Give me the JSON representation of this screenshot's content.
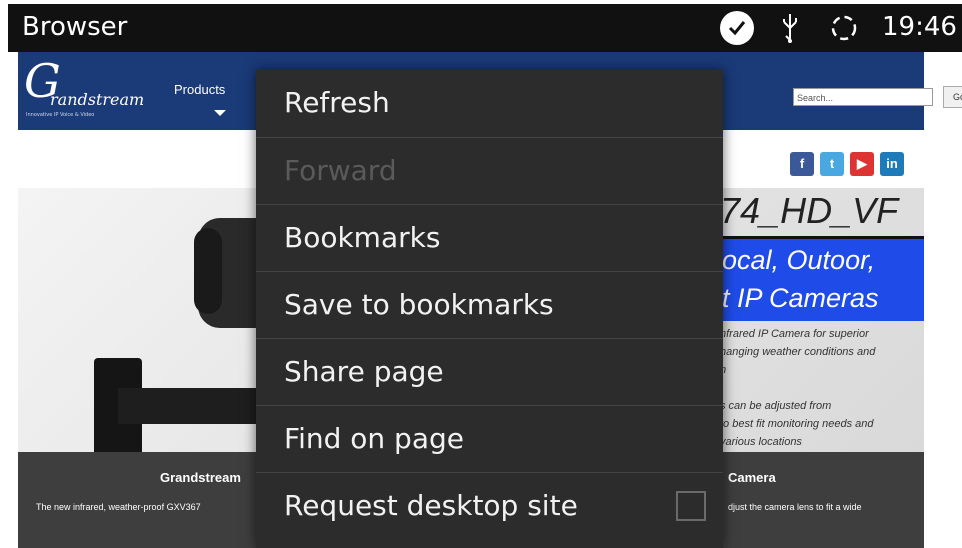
{
  "statusbar": {
    "title": "Browser",
    "clock": "19:46",
    "icons": [
      "checkmark-badge-icon",
      "usb-icon",
      "sync-icon"
    ]
  },
  "webpage": {
    "header": {
      "logo_letter": "G",
      "logo_word": "randstream",
      "logo_tagline": "Innovative IP Voice & Video",
      "nav_products": "Products",
      "search_placeholder": "Search...",
      "search_button": "Go"
    },
    "social": [
      {
        "icon": "facebook-icon",
        "glyph": "f",
        "color": "#3b5998"
      },
      {
        "icon": "twitter-icon",
        "glyph": "t",
        "color": "#4aa8e0"
      },
      {
        "icon": "youtube-icon",
        "glyph": "▶",
        "color": "#d33"
      },
      {
        "icon": "linkedin-icon",
        "glyph": "in",
        "color": "#1e7ab8"
      }
    ],
    "hero": {
      "model_heading": "74_HD_VF",
      "banner_line1": "ocal, Outoor,",
      "banner_line2": "t IP Cameras",
      "desc_lines": [
        "nfrared IP Camera for superior",
        "hanging weather conditions and",
        "n",
        "s can be adjusted from",
        "to best fit monitoring needs and",
        "various locations"
      ]
    },
    "footer": {
      "title_left": "Grandstream",
      "title_right": "Camera",
      "text_left": "The new infrared, weather-proof GXV367",
      "text_right": "djust the camera lens to fit a wide"
    }
  },
  "menu": {
    "items": [
      {
        "label": "Refresh",
        "enabled": true
      },
      {
        "label": "Forward",
        "enabled": false
      },
      {
        "label": "Bookmarks",
        "enabled": true
      },
      {
        "label": "Save to bookmarks",
        "enabled": true
      },
      {
        "label": "Share page",
        "enabled": true
      },
      {
        "label": "Find on page",
        "enabled": true
      },
      {
        "label": "Request desktop site",
        "enabled": true,
        "checkbox_checked": false
      }
    ]
  }
}
